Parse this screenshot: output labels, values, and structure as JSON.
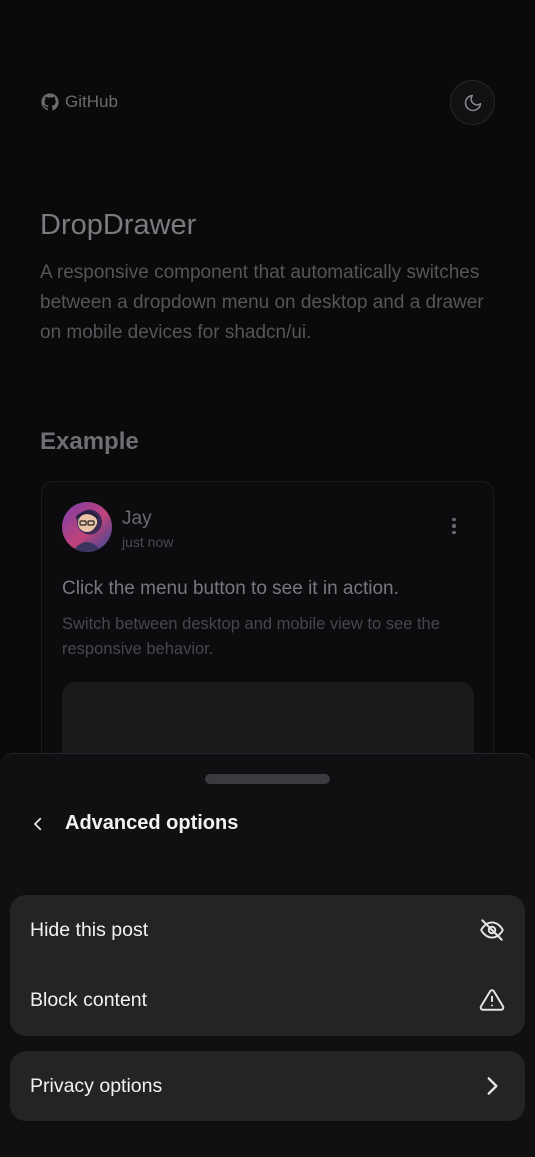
{
  "header": {
    "github_label": "GitHub",
    "github_icon": "github-icon",
    "theme_icon": "moon-icon"
  },
  "hero": {
    "title": "DropDrawer",
    "description": "A responsive component that automatically switches between a dropdown menu on desktop and a drawer on mobile devices for shadcn/ui."
  },
  "example": {
    "heading": "Example",
    "card": {
      "user_name": "Jay",
      "timestamp": "just now",
      "headline": "Click the menu button to see it in action.",
      "body": "Switch between desktop and mobile view to see the responsive behavior."
    }
  },
  "drawer": {
    "title": "Advanced options",
    "back_icon": "chevron-left-icon",
    "groups": [
      {
        "items": [
          {
            "label": "Hide this post",
            "icon": "eye-off-icon"
          },
          {
            "label": "Block content",
            "icon": "alert-triangle-icon"
          }
        ]
      },
      {
        "items": [
          {
            "label": "Privacy options",
            "icon": "chevron-right-icon"
          }
        ]
      }
    ]
  },
  "colors": {
    "background": "#0a0a0b",
    "drawer_bg": "#101012",
    "item_bg": "#242427",
    "text_primary": "#f2f2f4"
  }
}
